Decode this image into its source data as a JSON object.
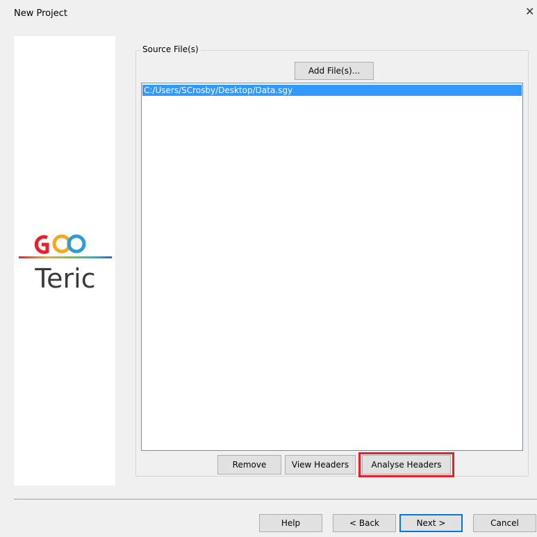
{
  "window": {
    "title": "New Project",
    "close_glyph": "✕"
  },
  "logo": {
    "top_text": "GEO",
    "bottom_text": "Teric"
  },
  "source_group": {
    "label": "Source File(s)",
    "add_button": "Add File(s)...",
    "files": [
      "C:/Users/SCrosby/Desktop/Data.sgy"
    ],
    "selected_index": 0,
    "remove_button": "Remove",
    "view_headers_button": "View Headers",
    "analyse_headers_button": "Analyse Headers"
  },
  "footer": {
    "help_button": "Help",
    "back_button": "< Back",
    "next_button": "Next >",
    "cancel_button": "Cancel"
  },
  "colors": {
    "selection": "#3399ff",
    "highlight_box": "#e8202a",
    "default_button_border": "#0078d7"
  }
}
